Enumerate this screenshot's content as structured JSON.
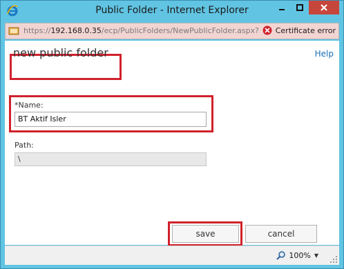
{
  "window": {
    "title": "Public Folder - Internet Explorer",
    "controls": {
      "minimize": "minimize-icon",
      "maximize": "maximize-icon",
      "close": "close-icon"
    },
    "colors": {
      "frame": "#61c4e3",
      "close_button": "#c7463c",
      "address_bar_error": "#f2d5d2"
    }
  },
  "address_bar": {
    "scheme": "https://",
    "host": "192.168.0.35",
    "path": "/ecp/PublicFolders/NewPublicFolder.aspx?pw",
    "certificate_status": "Certificate error"
  },
  "page": {
    "help_link": "Help",
    "heading": "new public folder",
    "name_field": {
      "label": "*Name:",
      "value": "BT Aktif Isler"
    },
    "path_field": {
      "label": "Path:",
      "value": "\\"
    },
    "buttons": {
      "save": "save",
      "cancel": "cancel"
    },
    "highlight_color": "#d0212b"
  },
  "status_bar": {
    "zoom": "100%"
  }
}
